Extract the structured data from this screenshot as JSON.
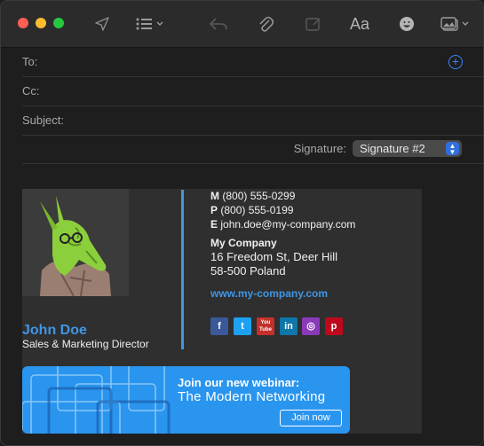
{
  "compose": {
    "to_label": "To:",
    "cc_label": "Cc:",
    "subject_label": "Subject:",
    "signature_label": "Signature:",
    "signature_selected": "Signature #2"
  },
  "toolbar": {
    "format_label": "Aa"
  },
  "signature": {
    "name": "John Doe",
    "role": "Sales & Marketing Director",
    "mobile_prefix": "M",
    "mobile": "(800) 555-0299",
    "phone_prefix": "P",
    "phone": "(800) 555-0199",
    "email_prefix": "E",
    "email": "john.doe@my-company.com",
    "company": "My Company",
    "address_line1": "16 Freedom St, Deer Hill",
    "address_line2": "58-500 Poland",
    "website": "www.my-company.com",
    "social": [
      {
        "name": "facebook",
        "glyph": "f",
        "color": "#3b5998"
      },
      {
        "name": "twitter",
        "glyph": "t",
        "color": "#1da1f2"
      },
      {
        "name": "youtube",
        "glyph": "You Tube",
        "color": "#c4302b"
      },
      {
        "name": "linkedin",
        "glyph": "in",
        "color": "#0e76a8"
      },
      {
        "name": "instagram",
        "glyph": "◎",
        "color": "#8a3ab9"
      },
      {
        "name": "pinterest",
        "glyph": "p",
        "color": "#bd081c"
      }
    ],
    "banner": {
      "line1": "Join our new webinar:",
      "line2": "The Modern Networking",
      "button": "Join now"
    }
  }
}
